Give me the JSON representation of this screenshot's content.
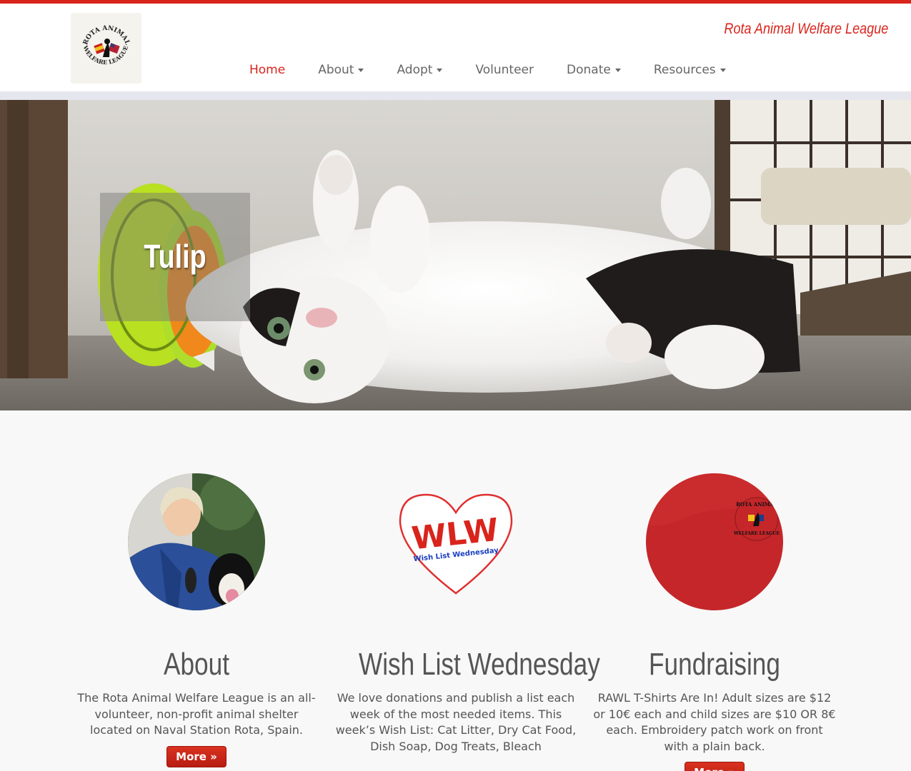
{
  "colors": {
    "accent": "#d9241c",
    "text": "#555555",
    "nav_text": "#666666"
  },
  "header": {
    "brand": "Rota Animal Welfare League",
    "logo_text_top": "ROTA ANIMAL",
    "logo_text_bottom": "WELFARE LEAGUE"
  },
  "nav": {
    "items": [
      {
        "label": "Home",
        "active": true,
        "dropdown": false
      },
      {
        "label": "About",
        "active": false,
        "dropdown": true
      },
      {
        "label": "Adopt",
        "active": false,
        "dropdown": true
      },
      {
        "label": "Volunteer",
        "active": false,
        "dropdown": false
      },
      {
        "label": "Donate",
        "active": false,
        "dropdown": true
      },
      {
        "label": "Resources",
        "active": false,
        "dropdown": true
      }
    ]
  },
  "hero": {
    "caption": "Tulip"
  },
  "features": [
    {
      "title": "About",
      "text": "The Rota Animal Welfare League is an all-volunteer, non-profit animal shelter located on Naval Station Rota, Spain.",
      "button": "More »"
    },
    {
      "title": "Wish List Wednesday",
      "text": "We love donations and publish a list each week of the most needed items. This week’s Wish List: Cat Litter, Dry Cat Food, Dish Soap, Dog Treats, Bleach",
      "wlw_logo": "WLW",
      "wlw_sub": "Wish List Wednesday"
    },
    {
      "title": "Fundraising",
      "text": "RAWL T-Shirts Are In! Adult sizes are $12 or 10€ each and child sizes are $10 OR 8€ each. Embroidery patch work on front with a plain back.",
      "button": "More »"
    }
  ]
}
